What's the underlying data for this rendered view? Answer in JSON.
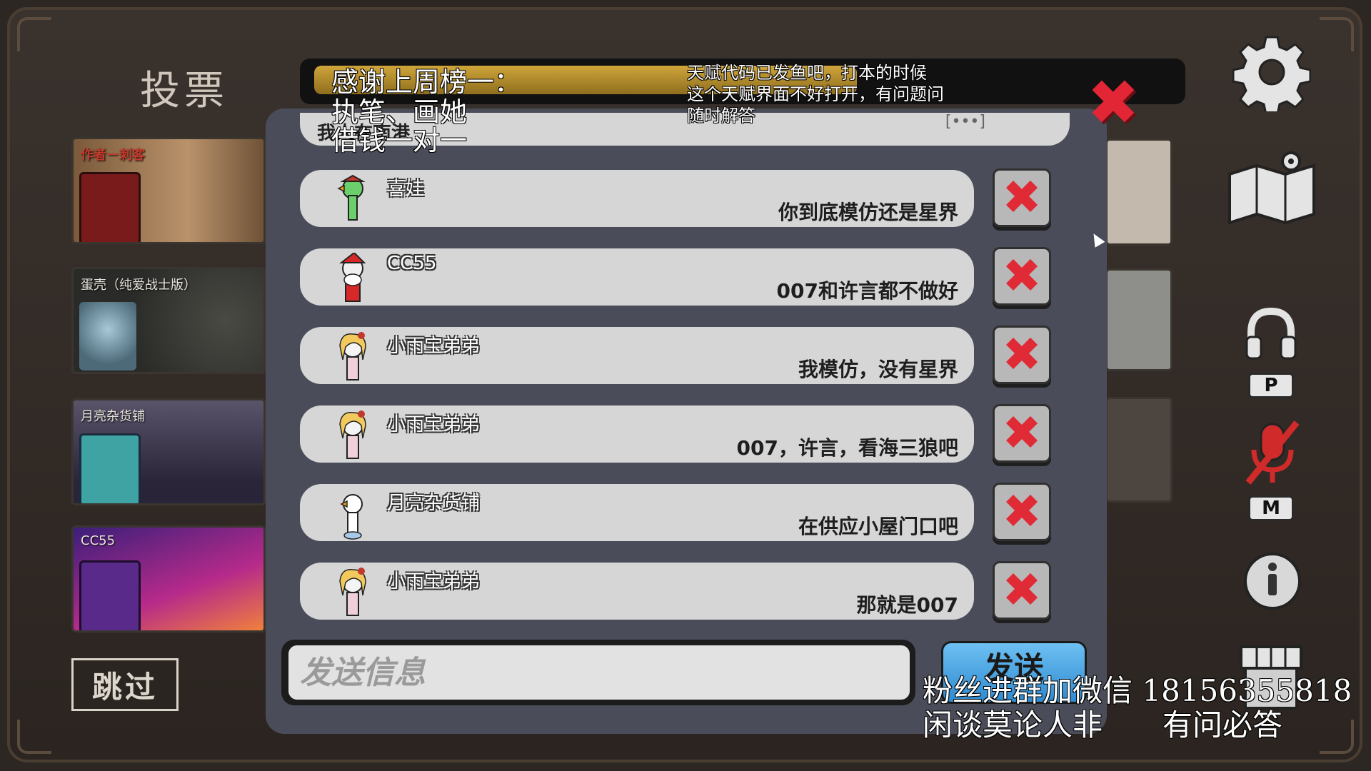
{
  "screen": {
    "title": "投票"
  },
  "player_cards": [
    {
      "name": "作者－刺客",
      "name_color": "#c43b2c"
    },
    {
      "name": "蛋壳（纯爱战士版）"
    },
    {
      "name": "月亮杂货铺"
    },
    {
      "name": "CC55"
    }
  ],
  "skip_button": "跳过",
  "chat": {
    "partial_message": {
      "sender": "我人在南港",
      "tag": "[•••]"
    },
    "messages": [
      {
        "sender": "喜娃",
        "text": "你到底模仿还是星界",
        "avatar": "green-goose-avatar"
      },
      {
        "sender": "CC55",
        "text": "007和许言都不做好",
        "avatar": "santa-goose-avatar"
      },
      {
        "sender": "小雨宝弟弟",
        "text": "我模仿，没有星界",
        "avatar": "blonde-goose-avatar"
      },
      {
        "sender": "小雨宝弟弟",
        "text": "007，许言，看海三狼吧",
        "avatar": "blonde-goose-avatar"
      },
      {
        "sender": "月亮杂货铺",
        "text": "在供应小屋门口吧",
        "avatar": "white-goose-avatar"
      },
      {
        "sender": "小雨宝弟弟",
        "text": "那就是007",
        "avatar": "blonde-goose-avatar"
      }
    ],
    "report_icon": "red-x-icon",
    "input_placeholder": "发送信息",
    "send_label": "发送"
  },
  "side_menu": {
    "push_to_talk_key": "P",
    "mute_key": "M"
  },
  "stream_overlay": {
    "thanks_line1": "感谢上周榜一：",
    "thanks_line2": "执笔、画她",
    "thanks_line3": "借钱一对一",
    "notice_line1": "天赋代码已发鱼吧，打本的时候",
    "notice_line2": "这个天赋界面不好打开，有问题问",
    "notice_line3": "随时解答",
    "fan_line1": "粉丝进群加微信 18156355818",
    "fan_line2": "闲谈莫论人非　　有问必答"
  },
  "colors": {
    "accent_red": "#e02a35",
    "send_blue": "#4fa6e4",
    "panel": "#4a4d59",
    "bubble": "#d6d6d6"
  }
}
